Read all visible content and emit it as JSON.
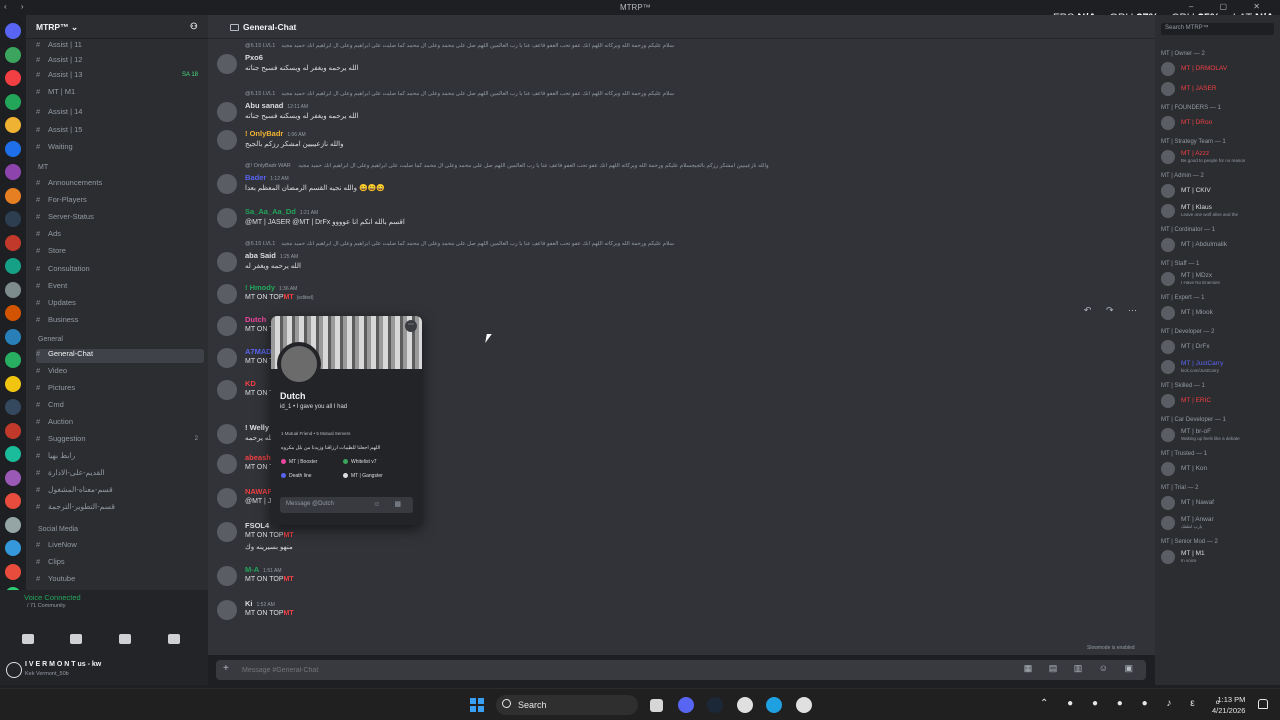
{
  "window": {
    "title": "MTRP™"
  },
  "overlay": {
    "fps_label": "FPS",
    "fps": "N/A",
    "gpu_label": "GPU",
    "gpu": "27%",
    "cpu_label": "CPU",
    "cpu": "25%",
    "lat_label": "LAT",
    "lat": "N/A"
  },
  "sidebar": {
    "server_name": "MTRP™",
    "assist": [
      {
        "label": "Assist | 11"
      },
      {
        "label": "Assist | 12"
      },
      {
        "label": "Assist | 13",
        "badge": "SA 18"
      },
      {
        "label": "MT | M1"
      },
      {
        "label": "Assist | 14"
      },
      {
        "label": "Assist | 15"
      },
      {
        "label": "Waiting"
      }
    ],
    "categories": {
      "mt": "MT",
      "general": "General",
      "social": "Social Media"
    },
    "mt_channels": [
      {
        "label": "Announcements"
      },
      {
        "label": "For-Players"
      },
      {
        "label": "Server-Status"
      },
      {
        "label": "Ads"
      },
      {
        "label": "Store"
      },
      {
        "label": "Consultation"
      },
      {
        "label": "Event"
      },
      {
        "label": "Updates"
      },
      {
        "label": "Business"
      }
    ],
    "general_channels": [
      {
        "label": "General-Chat",
        "active": true
      },
      {
        "label": "Video"
      },
      {
        "label": "Pictures"
      },
      {
        "label": "Cmd"
      },
      {
        "label": "Auction"
      },
      {
        "label": "Suggestion",
        "count": "2"
      },
      {
        "label": "رابط بهيا"
      },
      {
        "label": "القديم-على-الادارة"
      },
      {
        "label": "قسم-معناه-المشغول"
      },
      {
        "label": "قسم-التطوير-الترجمة"
      }
    ],
    "social_channels": [
      {
        "label": "LiveNow"
      },
      {
        "label": "Clips"
      },
      {
        "label": "Youtube"
      }
    ]
  },
  "voice": {
    "status": "Voice Connected",
    "server": "/ 71 Community"
  },
  "user": {
    "name": "I V E R M O N T us - kw",
    "status": "Kek Vermont_50b"
  },
  "chat": {
    "channel": "General-Chat",
    "arabic_long": "سلام عليكم ورحمة الله وبركاته اللهم انك عفو تحب العفو فاعف عنا يا رب العالمين اللهم صل على محمد وعلى آل محمد كما صليت على ابراهيم وعلى آل ابراهيم انك حميد مجيد",
    "messages": [
      {
        "reply": "@6.15 LVL1",
        "name": "Pxo6",
        "text": "الله يرحمه ويغفر له ويسكنه فسيح جناته",
        "color": "#dbdee1"
      },
      {
        "reply": "@6.15 LVL1",
        "name": "Abu sanad",
        "time": "12:11 AM",
        "text": "الله يرحمه ويغفر له ويسكنه فسيح جناته",
        "color": "#dbdee1"
      },
      {
        "name": "! OnlyBadr",
        "time": "1:06 AM",
        "text": "والله نازعيبيين امشكر رزكم بالجيج",
        "color": "#f0b232"
      },
      {
        "reply": "@! OnlyBadr WAR والله نازعيبيين امشكر رزكم بالجيج",
        "name": "Bader",
        "time": "1:12 AM",
        "text": "والله نجيه القسم الرمضان المعظم بعدا 😄😄😄",
        "color": "#5865f2"
      },
      {
        "name": "Sa_Aa_Aa_Dd",
        "time": "1:21 AM",
        "text": "@MT | JASER @MT | DrFx اقسم بالله انكم انا عوووو",
        "color": "#23a55a"
      },
      {
        "reply": "@6.15 LVL1",
        "name": "aba Said",
        "time": "1:25 AM",
        "text": "الله يرحمه ويغفر له",
        "color": "#dbdee1"
      },
      {
        "name": "! Hmody",
        "time": "1:36 AM",
        "text": "MT ON TOP",
        "edited": "(edited)",
        "color": "#23a55a"
      },
      {
        "name": "Dutch",
        "text": "MT ON TOP",
        "color": "#eb459e"
      },
      {
        "name": "A7MAD",
        "text": "MT ON TOP",
        "color": "#5865f2"
      },
      {
        "name": "KD",
        "text": "MT ON TOP",
        "color": "#f23f43"
      },
      {
        "name": "! Welly",
        "text": "الله يرحمه",
        "color": "#dbdee1"
      },
      {
        "name": "abeash",
        "text": "MT ON TOP",
        "color": "#f23f43"
      },
      {
        "name": "NAWAF",
        "text": "@MT | JASER",
        "color": "#f23f43"
      },
      {
        "name": "FSOL4",
        "text": "MT ON TOP",
        "extra": "منهو بسيرينه وك",
        "color": "#dbdee1"
      },
      {
        "name": "M-A",
        "time": "1:51 AM",
        "text": "MT ON TOP",
        "color": "#23a55a"
      },
      {
        "name": "Ki",
        "time": "1:52 AM",
        "text": "MT ON TOP",
        "color": "#dbdee1"
      }
    ],
    "mt_suffix": "MT",
    "composer_placeholder": "Message #General-Chat",
    "slowmode": "Slowmode is enabled"
  },
  "popup": {
    "name": "Dutch",
    "tag": "id_1 • I gave you all I had",
    "mutual": "1 Mutual Friend • 5 Mutual Servers",
    "bio": "اللهم اجعلنا للطيبات ارزاقنا وزيدنا من بلل مكروه",
    "roles": [
      {
        "label": "MT | Booster",
        "color": "#eb459e"
      },
      {
        "label": "Whitelist v7",
        "color": "#3ba55d"
      },
      {
        "label": "Death line",
        "color": "#5865f2"
      },
      {
        "label": "MT | Gangster",
        "color": "#dbdee1"
      }
    ],
    "message_placeholder": "Message @Dutch"
  },
  "members": {
    "search": "Search MTRP™",
    "groups": [
      {
        "title": "MT | Owner — 2",
        "items": [
          {
            "name": "MT | DRMOLAV",
            "color": "#f23f43"
          },
          {
            "name": "MT | JASER",
            "color": "#f23f43"
          }
        ]
      },
      {
        "title": "MT | FOUNDERS — 1",
        "items": [
          {
            "name": "MT | DRoo",
            "color": "#f23f43"
          }
        ]
      },
      {
        "title": "MT | Strategy Team — 1",
        "items": [
          {
            "name": "MT | Azzz",
            "status": "Be good to people for no reason",
            "color": "#f23f43"
          }
        ]
      },
      {
        "title": "MT | Admin — 2",
        "items": [
          {
            "name": "MT | CKIV",
            "color": "#dbdee1"
          },
          {
            "name": "MT | Klaus",
            "status": "Leave one wolf alive and the",
            "color": "#dbdee1"
          }
        ]
      },
      {
        "title": "MT | Cordinator — 1",
        "items": [
          {
            "name": "MT | Abdulmalik",
            "color": "#949ba4"
          }
        ]
      },
      {
        "title": "MT | Staff — 1",
        "items": [
          {
            "name": "MT | MDzx",
            "status": "I Have No Enemies",
            "color": "#949ba4"
          }
        ]
      },
      {
        "title": "MT | Expert — 1",
        "items": [
          {
            "name": "MT | Mlook",
            "color": "#949ba4"
          }
        ]
      },
      {
        "title": "MT | Developer — 2",
        "items": [
          {
            "name": "MT | DrFx",
            "color": "#949ba4"
          },
          {
            "name": "MT | JustCarry",
            "status": "kick.com/JustCarry",
            "color": "#5865f2"
          }
        ]
      },
      {
        "title": "MT | Skilled — 1",
        "items": [
          {
            "name": "MT | ERIC",
            "color": "#f23f43"
          }
        ]
      },
      {
        "title": "MT | Car Developer — 1",
        "items": [
          {
            "name": "MT | br-oF",
            "status": "Waking up feels like a debate",
            "color": "#949ba4"
          }
        ]
      },
      {
        "title": "MT | Trusted — 1",
        "items": [
          {
            "name": "MT | Kon",
            "color": "#949ba4"
          }
        ]
      },
      {
        "title": "MT | Trial — 2",
        "items": [
          {
            "name": "MT | Nawaf",
            "color": "#949ba4"
          },
          {
            "name": "MT | Anwar",
            "status": "يارب لطفك",
            "color": "#949ba4"
          }
        ]
      },
      {
        "title": "MT | Senior Mod — 2",
        "items": [
          {
            "name": "MT | M1",
            "status": "In voice",
            "color": "#dbdee1"
          }
        ]
      }
    ]
  },
  "taskbar": {
    "search": "Search",
    "time": "1:13 PM",
    "date": "4/21/2026"
  }
}
